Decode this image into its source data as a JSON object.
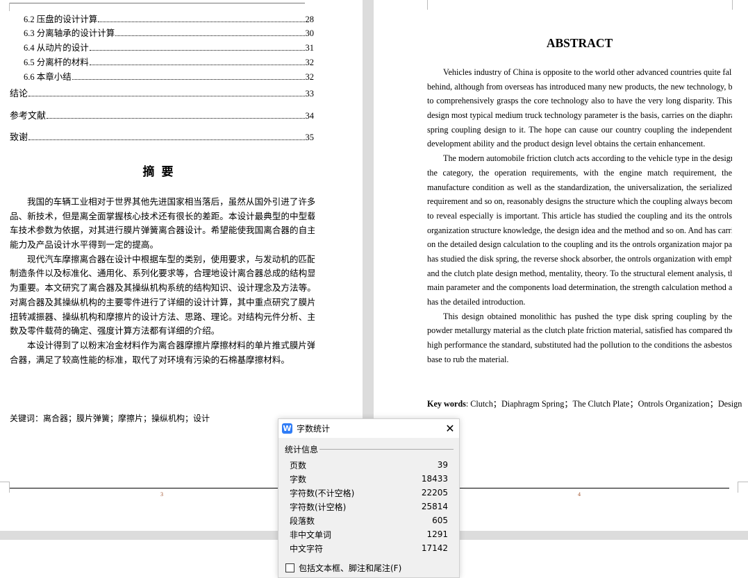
{
  "left_page": {
    "toc": [
      {
        "label": "6.2 压盘的设计计算",
        "page": "28",
        "level": 2
      },
      {
        "label": "6.3 分离轴承的设计计算",
        "page": "30",
        "level": 2
      },
      {
        "label": "6.4 从动片的设计",
        "page": "31",
        "level": 2
      },
      {
        "label": "6.5 分离杆的材料",
        "page": "32",
        "level": 2
      },
      {
        "label": "6.6 本章小结",
        "page": "32",
        "level": 2
      },
      {
        "label": "结论",
        "page": "33",
        "level": 1
      },
      {
        "label": "参考文献",
        "page": "34",
        "level": 1
      },
      {
        "label": "致谢",
        "page": "35",
        "level": 1
      }
    ],
    "heading": "摘要",
    "paragraphs": [
      [
        "我国的车辆工业相对于世界其他先进国家相当落后，虽然从国外引进了许多新产",
        "品、新技术，但是离全面掌握核心技术还有很长的差距。本设计最典型的中型载货汽",
        "车技术参数为依据，对其进行膜片弹簧离合器设计。希望能使我国离合器的自主开发",
        "能力及产品设计水平得到一定的提高。"
      ],
      [
        "现代汽车摩擦离合器在设计中根据车型的类别，使用要求，与发动机的匹配要求，",
        "制造条件以及标准化、通用化、系列化要求等，合理地设计离合器总成的结构显的尤",
        "为重要。本文研究了离合器及其操纵机构系统的结构知识、设计理念及方法等。并且",
        "对离合器及其操纵机构的主要零件进行了详细的设计计算，其中重点研究了膜片弹簧、",
        "扭转减振器、操纵机构和摩擦片的设计方法、思路、理论。对结构元件分析、主要参",
        "数及零件载荷的确定、强度计算方法都有详细的介绍。"
      ],
      [
        "本设计得到了以粉末冶金材料作为离合器摩擦片摩擦材料的单片推式膜片弹簧离",
        "合器，满足了较高性能的标准，取代了对环境有污染的石棉基摩擦材料。"
      ]
    ],
    "keywords": "关键词：离合器；膜片弹簧；摩擦片；操纵机构；设计",
    "page_number": "3"
  },
  "right_page": {
    "heading": "ABSTRACT",
    "paragraphs": [
      [
        "Vehicles industry of China is opposite to the world other advanced countries quite falls",
        "behind, although from overseas has introduced many new products, the new technology, but",
        "to comprehensively grasps the core technology also to have the very long disparity. This",
        "design most typical medium truck technology parameter is the basis, carries on the diaphragm",
        "spring coupling design to it. The hope can cause our country coupling the independent",
        "development ability and the product design level obtains the certain enhancement."
      ],
      [
        "The modern automobile friction clutch acts according to the vehicle type in the design",
        "the category, the operation requirements, with the engine match requirement, the",
        "manufacture condition as well as the standardization, the universalization, the serialized",
        "requirement and so on, reasonably designs the structure which the coupling always becomes",
        "to reveal especially is important. This article has studied the coupling and its the ontrols",
        "organization structure knowledge, the design idea and the method and so on. And has carried",
        "on the detailed design calculation to the coupling and its the ontrols organization major parts,",
        "has studied the disk spring, the reverse shock absorber, the ontrols organization with emphasis",
        "and the clutch plate design method, mentality, theory. To the structural element analysis, the",
        "main parameter and the components load determination, the strength calculation method all",
        "has the detailed introduction."
      ],
      [
        "This design obtained monolithic has pushed the type disk spring coupling by the",
        "powder metallurgy material as the clutch plate friction material, satisfied has compared the",
        "high performance the standard, substituted had the pollution to the conditions the asbestos",
        "base to rub the material."
      ]
    ],
    "keywords_label": "Key words",
    "keywords": ": Clutch；Diaphragm Spring；The Clutch Plate；Ontrols Organization；Design",
    "page_number": "4"
  },
  "word_count_dialog": {
    "title": "字数统计",
    "section": "统计信息",
    "stats": [
      {
        "label": "页数",
        "value": "39"
      },
      {
        "label": "字数",
        "value": "18433"
      },
      {
        "label": "字符数(不计空格)",
        "value": "22205"
      },
      {
        "label": "字符数(计空格)",
        "value": "25814"
      },
      {
        "label": "段落数",
        "value": "605"
      },
      {
        "label": "非中文单词",
        "value": "1291"
      },
      {
        "label": "中文字符",
        "value": "17142"
      }
    ],
    "include_checkbox_label": "包括文本框、脚注和尾注(F)",
    "include_checked": false,
    "app_icon_letter": "W"
  }
}
